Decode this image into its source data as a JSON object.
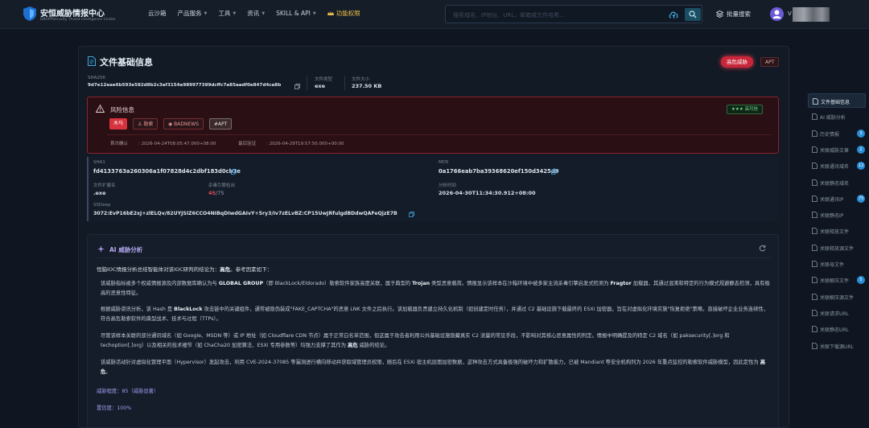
{
  "header": {
    "brand_title": "安恒威胁情报中心",
    "brand_subtitle": "DBAPPSecurity Threat Intelligence Center",
    "nav": [
      {
        "label": "云沙箱",
        "has_dropdown": false
      },
      {
        "label": "产品服务",
        "has_dropdown": true
      },
      {
        "label": "工具",
        "has_dropdown": true
      },
      {
        "label": "资讯",
        "has_dropdown": true
      },
      {
        "label": "SKILL & API",
        "has_dropdown": true
      },
      {
        "label": "功能权限",
        "has_dropdown": false
      }
    ],
    "search_placeholder": "搜索域名、IP地址、URL，邮箱或文件哈希...",
    "batch_search_label": "批量搜索",
    "user_initial": "V"
  },
  "file": {
    "title": "文件基础信息",
    "threat_badge": "高危威胁",
    "apt_badge": "APT",
    "sha256_label": "SHA256",
    "sha256": "9d7e12eae6b593e582d8b2c3af3154a989977389dcffc7a85aadf0e847d4ca8b",
    "type_label": "文件类型",
    "type": "exe",
    "size_label": "文件大小",
    "size": "237.50 KB"
  },
  "risk": {
    "title": "风险信息",
    "credibility": "★★★ 高可信",
    "tags": [
      "木马",
      "勒索",
      "BADNEWS",
      "#APT"
    ],
    "first_seen_label": "首次确认",
    "first_seen": "2026-04-24T08:05:47.000+08:00",
    "last_seen_label": "最后验证",
    "last_seen": "2026-04-29T19:57:50.000+00:00"
  },
  "hashes": {
    "sha1_label": "SHA1",
    "sha1": "fd4133763a260306a1f07828d4c2dbf183d0cb3e",
    "md5_label": "MD5",
    "md5": "0a1766eab7ba39368620ef150d3425d9",
    "ext_label": "文件扩展名",
    "ext": ".exe",
    "engine_label": "杀毒引擎检出",
    "engine_hits": "45",
    "engine_total": "/75",
    "analysis_time_label": "分析时间",
    "analysis_time": "2026-04-30T11:34:30.912+08:00",
    "ssdeep_label": "SSDeep",
    "ssdeep": "3072:EvP16bE2xJ+zlELQv/82UYJSIZ6CCO4NIBqDIwdGAIvY+5ry3/Iv7zELvBZ:CP15UwJRfulgdBDdwQAFeQjzE7B"
  },
  "ai": {
    "title": "AI 威胁分析",
    "intro_pre": "恒脑IOC情报分析总结智能体对该IOC研判的结论为：",
    "intro_verdict": "高危",
    "intro_post": "。参考因素如下：",
    "p1_a": "该威胁指标被多个权威情报源及内部数据库确认为与 ",
    "p1_b": "GLOBAL GROUP",
    "p1_c": "（即 BlackLock/Eldorado）勒索软件家族高度关联，属于典型的 ",
    "p1_d": "Trojan",
    "p1_e": " 类型恶意载荷。情报显示该样本在沙箱环境中被多家主流杀毒引擎启发式检测为 ",
    "p1_f": "Fragtor",
    "p1_g": " 加载器，其通过混淆和特定的行为模式规避静态检测，具有极高的恶意性特征。",
    "p2_a": "根据威胁资讯分析，该 Hash 是 ",
    "p2_b": "BlackLock",
    "p2_c": " 攻击链中的关键组件，通常被隐伪装成\"FAKE_CAPTCHA\"的恶意 LNK 文件之后执行。该加载器负责建立持久化机制（如创建定时任务），并通过 C2 基础设施下载最终的 ESXi 加密器，旨在对虚拟化环境实施\"恢复拒绝\"策略，直接破坏企业业务连续性，符合高危勒索软件的典型战术、技术与过程（TTPs）。",
    "p3_a": "尽管该样本关联的部分通讯域名（如 Google、MSDN 等）或 IP 地址（如 Cloudflare CDN 节点）属于正常白名单范围，但这属于攻击者利用公共基础设施隐藏真实 C2 流量的常见手段，不影响对其核心恶意属性的判定。情报中明确提及的特定 C2 域名（如 paksecurity[.]org 和 techoption[.]org）以及相关的技术细节（如 ChaCha20 加密算法、ESXi 专用参数等）均强力支撑了其作为 ",
    "p3_b": "高危",
    "p3_c": " 威胁的结论。",
    "p4_a": "该威胁活动针对虚拟化管理平面（Hypervisor）发起攻击，利用 CVE-2024-37085 等漏洞进行横向移动并获取域管理员权限，随后在 ESXi 宿主机层面加密数据，这种攻击方式具备极强的破坏力和扩散能力，已被 Mandiant 等安全机构列为 2026 年重点监控的勒索软件威胁模型，因此定性为 ",
    "p4_b": "高危",
    "p4_c": "。",
    "threat_level": "威胁程度：85（威胁显著）",
    "confidence": "置信度：100%"
  },
  "sidebar": [
    {
      "label": "文件基础信息",
      "count": "",
      "active": true
    },
    {
      "label": "AI 威胁分析",
      "count": "",
      "active": false
    },
    {
      "label": "历史情报",
      "count": "3",
      "active": false
    },
    {
      "label": "关联威胁文章",
      "count": "2",
      "active": false
    },
    {
      "label": "关联通讯域名",
      "count": "12",
      "active": false
    },
    {
      "label": "关联静态域名",
      "count": "",
      "active": false
    },
    {
      "label": "关联通讯IP",
      "count": "75",
      "active": false
    },
    {
      "label": "关联静态IP",
      "count": "",
      "active": false
    },
    {
      "label": "关联释放文件",
      "count": "",
      "active": false
    },
    {
      "label": "关联释放源文件",
      "count": "",
      "active": false
    },
    {
      "label": "关联母文件",
      "count": "",
      "active": false
    },
    {
      "label": "关联解压文件",
      "count": "5",
      "active": false
    },
    {
      "label": "关联解压源文件",
      "count": "",
      "active": false
    },
    {
      "label": "关联请求URL",
      "count": "",
      "active": false
    },
    {
      "label": "关联静态URL",
      "count": "",
      "active": false
    },
    {
      "label": "关联下载源URL",
      "count": "",
      "active": false
    }
  ],
  "colors": {
    "accent": "#2b8fd6",
    "danger": "#d6333f",
    "ai": "#b6a8f0"
  }
}
